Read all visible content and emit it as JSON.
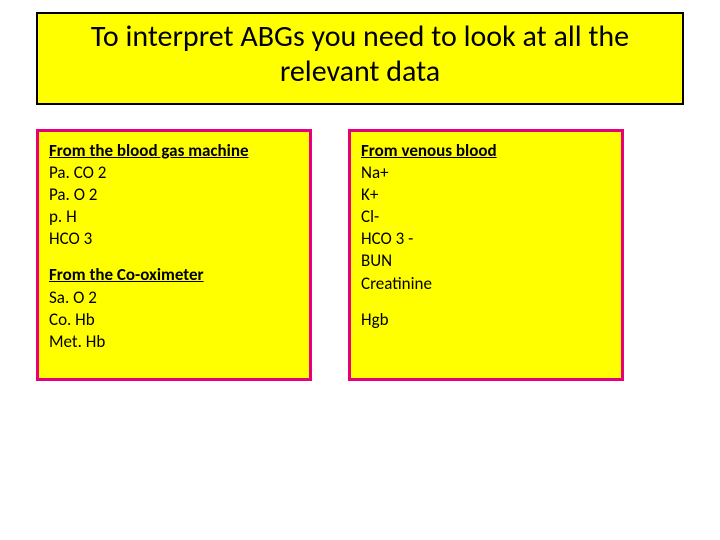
{
  "title": {
    "line1": "To interpret ABGs you need to look at all the",
    "line2": "relevant data"
  },
  "left": {
    "sections": [
      {
        "header": "From the blood gas machine",
        "items": [
          "Pa. CO 2",
          "Pa. O 2",
          "p. H",
          "HCO 3"
        ]
      },
      {
        "header": "From the Co-oximeter",
        "items": [
          "Sa. O 2",
          "Co. Hb",
          "Met. Hb"
        ]
      }
    ]
  },
  "right": {
    "sections": [
      {
        "header": "From venous blood",
        "items": [
          "Na+",
          "K+",
          "Cl-",
          "HCO 3 -",
          "BUN",
          "Creatinine"
        ]
      },
      {
        "header": "",
        "items": [
          "Hgb"
        ]
      }
    ]
  }
}
